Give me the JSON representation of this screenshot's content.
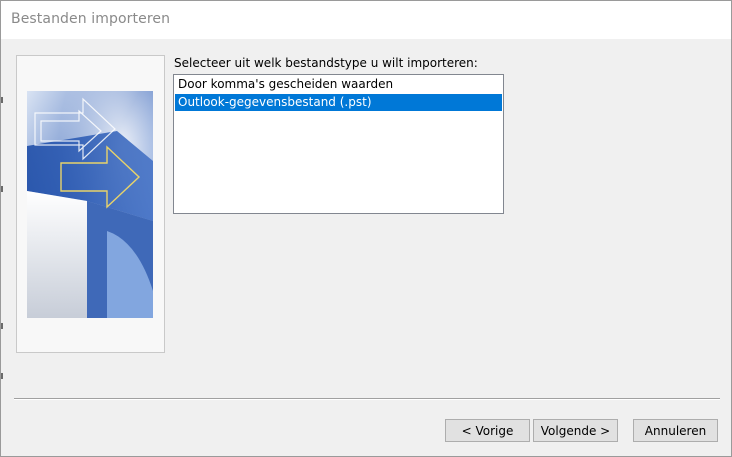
{
  "window": {
    "title": "Bestanden importeren"
  },
  "wizard": {
    "prompt": "Selecteer uit welk bestandstype u wilt importeren:",
    "file_types": [
      {
        "label": "Door komma's gescheiden waarden",
        "selected": false
      },
      {
        "label": "Outlook-gegevensbestand (.pst)",
        "selected": true
      }
    ]
  },
  "buttons": {
    "back": "< Vorige",
    "next": "Volgende >",
    "cancel": "Annuleren"
  },
  "colors": {
    "selection": "#0078d7",
    "dialog_background": "#f0f0f0",
    "title_text": "#8a8a8a"
  }
}
